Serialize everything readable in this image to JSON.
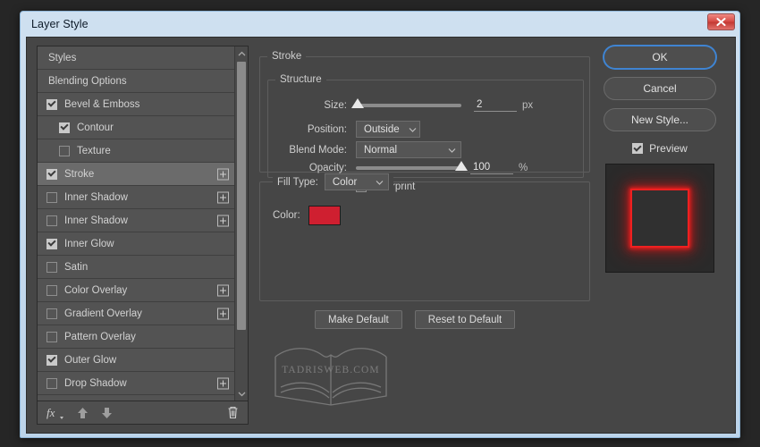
{
  "window": {
    "title": "Layer Style",
    "close_label": "Close"
  },
  "styles_panel": {
    "items": [
      {
        "label": "Styles",
        "checkbox": "none",
        "indent": "plain",
        "selected": false,
        "plus": false
      },
      {
        "label": "Blending Options",
        "checkbox": "none",
        "indent": "plain",
        "selected": false,
        "plus": false
      },
      {
        "label": "Bevel & Emboss",
        "checkbox": "checked",
        "indent": "normal",
        "selected": false,
        "plus": false
      },
      {
        "label": "Contour",
        "checkbox": "checked",
        "indent": "indent",
        "selected": false,
        "plus": false
      },
      {
        "label": "Texture",
        "checkbox": "unchecked",
        "indent": "indent",
        "selected": false,
        "plus": false
      },
      {
        "label": "Stroke",
        "checkbox": "checked",
        "indent": "normal",
        "selected": true,
        "plus": true
      },
      {
        "label": "Inner Shadow",
        "checkbox": "unchecked",
        "indent": "normal",
        "selected": false,
        "plus": true
      },
      {
        "label": "Inner Shadow",
        "checkbox": "unchecked",
        "indent": "normal",
        "selected": false,
        "plus": true
      },
      {
        "label": "Inner Glow",
        "checkbox": "checked",
        "indent": "normal",
        "selected": false,
        "plus": false
      },
      {
        "label": "Satin",
        "checkbox": "unchecked",
        "indent": "normal",
        "selected": false,
        "plus": false
      },
      {
        "label": "Color Overlay",
        "checkbox": "unchecked",
        "indent": "normal",
        "selected": false,
        "plus": true
      },
      {
        "label": "Gradient Overlay",
        "checkbox": "unchecked",
        "indent": "normal",
        "selected": false,
        "plus": true
      },
      {
        "label": "Pattern Overlay",
        "checkbox": "unchecked",
        "indent": "normal",
        "selected": false,
        "plus": false
      },
      {
        "label": "Outer Glow",
        "checkbox": "checked",
        "indent": "normal",
        "selected": false,
        "plus": false
      },
      {
        "label": "Drop Shadow",
        "checkbox": "unchecked",
        "indent": "normal",
        "selected": false,
        "plus": true
      }
    ],
    "toolbar": {
      "fx_label": "fx",
      "move_up": "move-up",
      "move_down": "move-down",
      "delete": "delete-effect"
    }
  },
  "settings": {
    "group_title": "Stroke",
    "structure": {
      "title": "Structure",
      "size": {
        "label": "Size:",
        "value": "2",
        "unit": "px",
        "knob_percent": 2
      },
      "position": {
        "label": "Position:",
        "value": "Outside"
      },
      "blend_mode": {
        "label": "Blend Mode:",
        "value": "Normal"
      },
      "opacity": {
        "label": "Opacity:",
        "value": "100",
        "unit": "%",
        "knob_percent": 100
      },
      "overprint": {
        "label": "Overprint",
        "checked": false
      }
    },
    "fill": {
      "fill_type_label": "Fill Type:",
      "fill_type_value": "Color",
      "color_label": "Color:",
      "color_value": "#cf1f30"
    },
    "buttons": {
      "make_default": "Make Default",
      "reset_to_default": "Reset to Default"
    },
    "watermark_text": "TADRISWEB.COM"
  },
  "actions": {
    "ok": "OK",
    "cancel": "Cancel",
    "new_style": "New Style...",
    "preview_label": "Preview",
    "preview_checked": true,
    "preview_stroke_color": "#ef2020"
  }
}
